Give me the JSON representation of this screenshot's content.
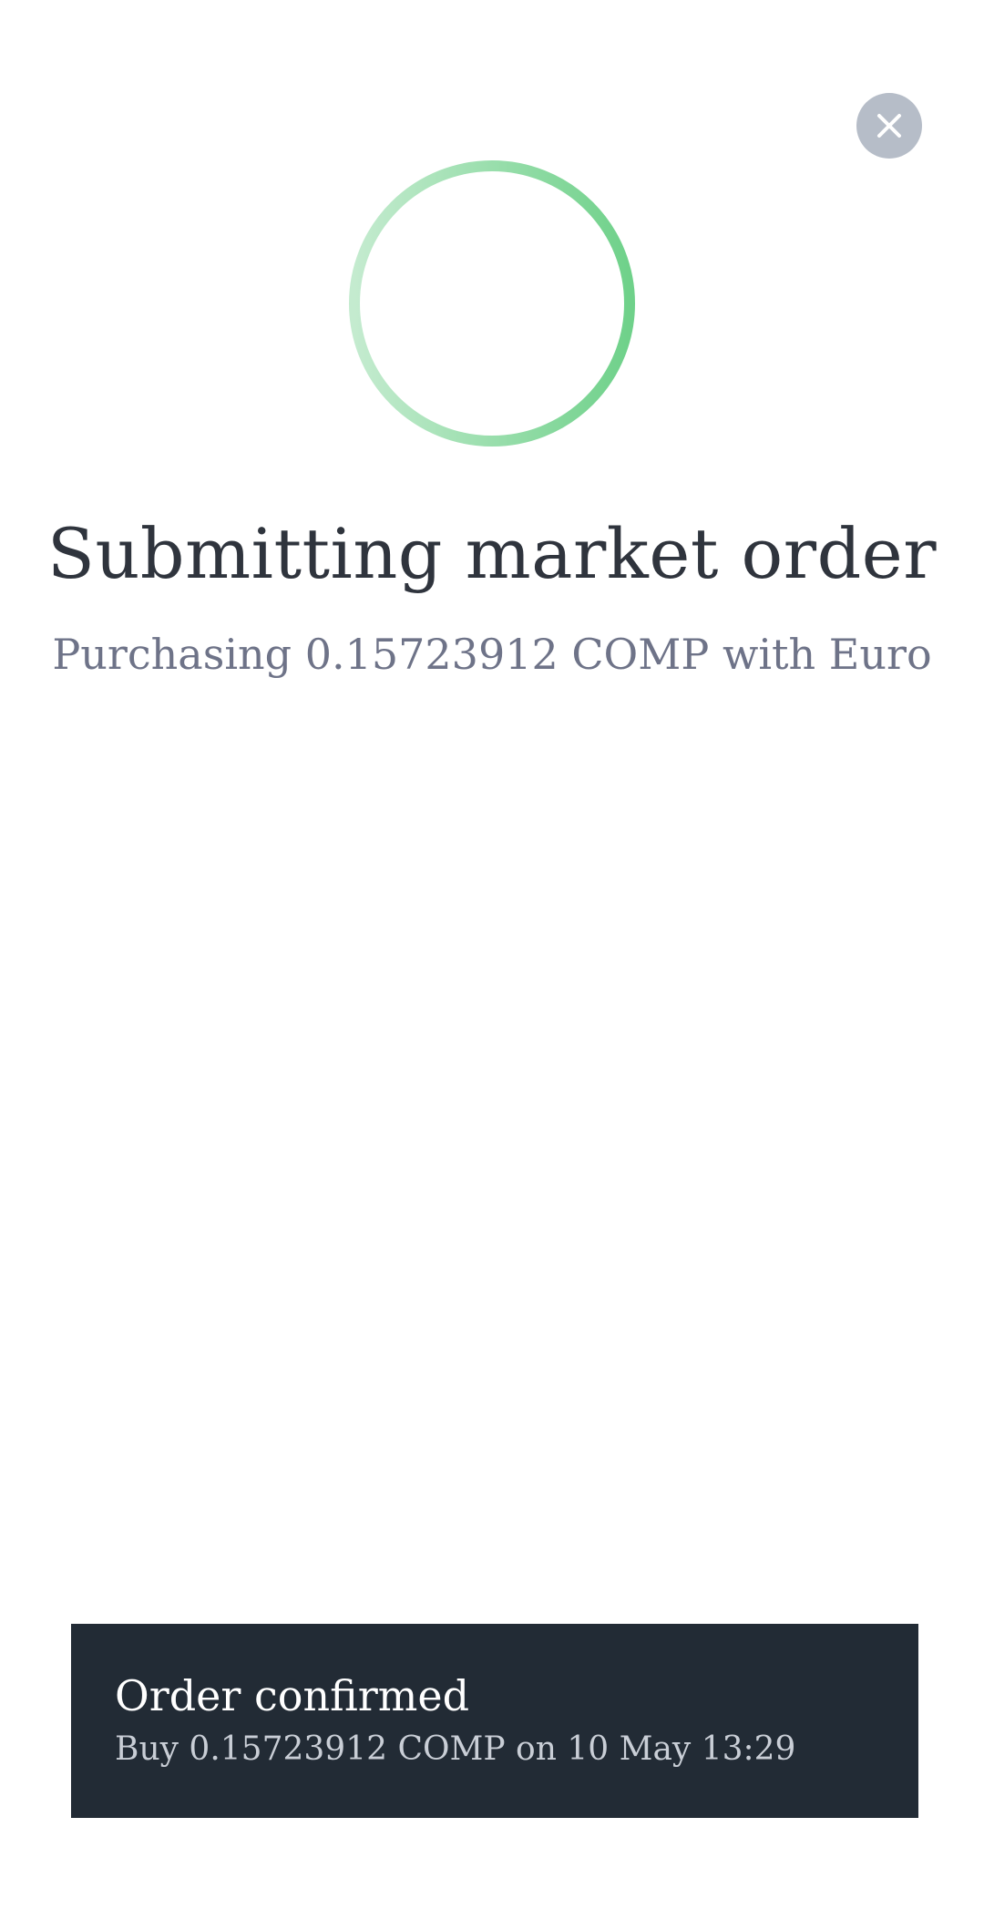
{
  "header": {
    "close_icon": "close-icon"
  },
  "status": {
    "spinner_icon": "loading-ring",
    "spinner_colors": [
      "#bfe8c9",
      "#6fd18a"
    ],
    "title": "Submitting market order",
    "subtitle": "Purchasing 0.15723912 COMP with Euro"
  },
  "toast": {
    "title": "Order confirmed",
    "body": "Buy 0.15723912 COMP on 10 May 13:29"
  },
  "colors": {
    "toast_background": "#222b35",
    "close_button_background": "#b6bdc8",
    "title_text": "#2f343d",
    "subtitle_text": "#6e7388"
  }
}
